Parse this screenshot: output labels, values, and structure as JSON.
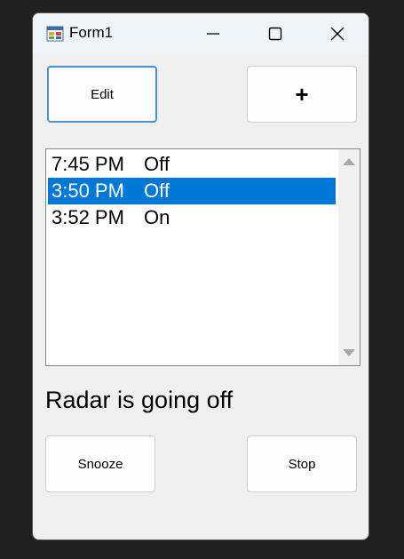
{
  "window": {
    "title": "Form1"
  },
  "toolbar": {
    "edit_label": "Edit",
    "add_label": "+"
  },
  "alarms": [
    {
      "time": "7:45 PM",
      "state": "Off",
      "selected": false
    },
    {
      "time": "3:50 PM",
      "state": "Off",
      "selected": true
    },
    {
      "time": "3:52 PM",
      "state": "On",
      "selected": false
    }
  ],
  "status": {
    "text": "Radar is going off"
  },
  "actions": {
    "snooze_label": "Snooze",
    "stop_label": "Stop"
  },
  "colors": {
    "selection": "#0078d7",
    "focus_border": "#4a90d9",
    "titlebar": "#eef4f8"
  },
  "icons": {
    "app": "form-app-icon",
    "minimize": "minimize-icon",
    "maximize": "maximize-icon",
    "close": "close-icon"
  }
}
